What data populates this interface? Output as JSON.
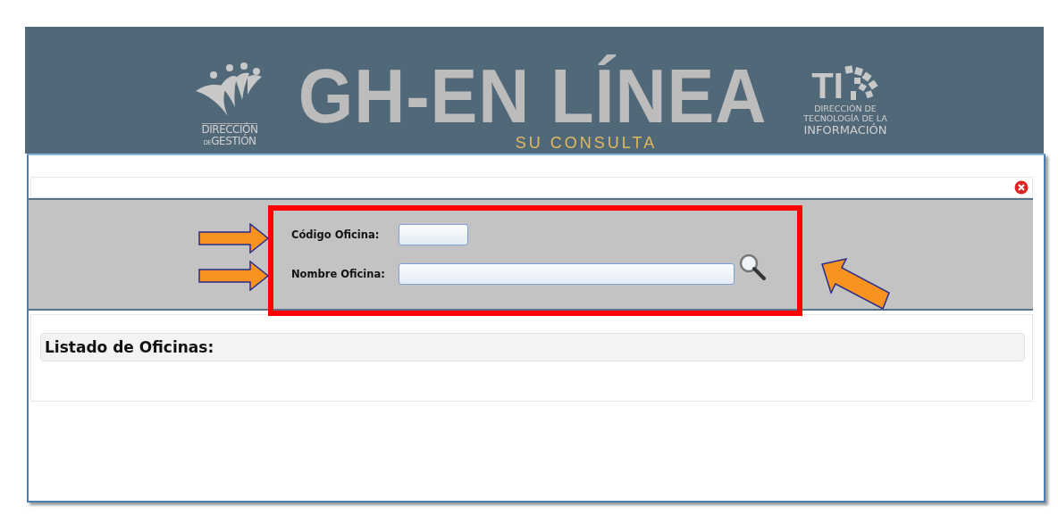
{
  "header": {
    "title": "GH-EN LÍNEA",
    "subtitle": "SU CONSULTA",
    "left_logo": {
      "line_1": "DIRECCIÓN",
      "line_2_prefix": "DE",
      "line_2": "GESTIÓN"
    },
    "right_logo": {
      "mark": "TI",
      "lines": [
        "DIRECCIÓN DE",
        "TECNOLOGÍA DE LA",
        "INFORMACIÓN"
      ]
    }
  },
  "search_form": {
    "fields": [
      {
        "label": "Código Oficina:",
        "kind": "short"
      },
      {
        "label": "Nombre Oficina:",
        "kind": "long"
      }
    ]
  },
  "results_panel": {
    "title": "Listado de Oficinas:"
  }
}
